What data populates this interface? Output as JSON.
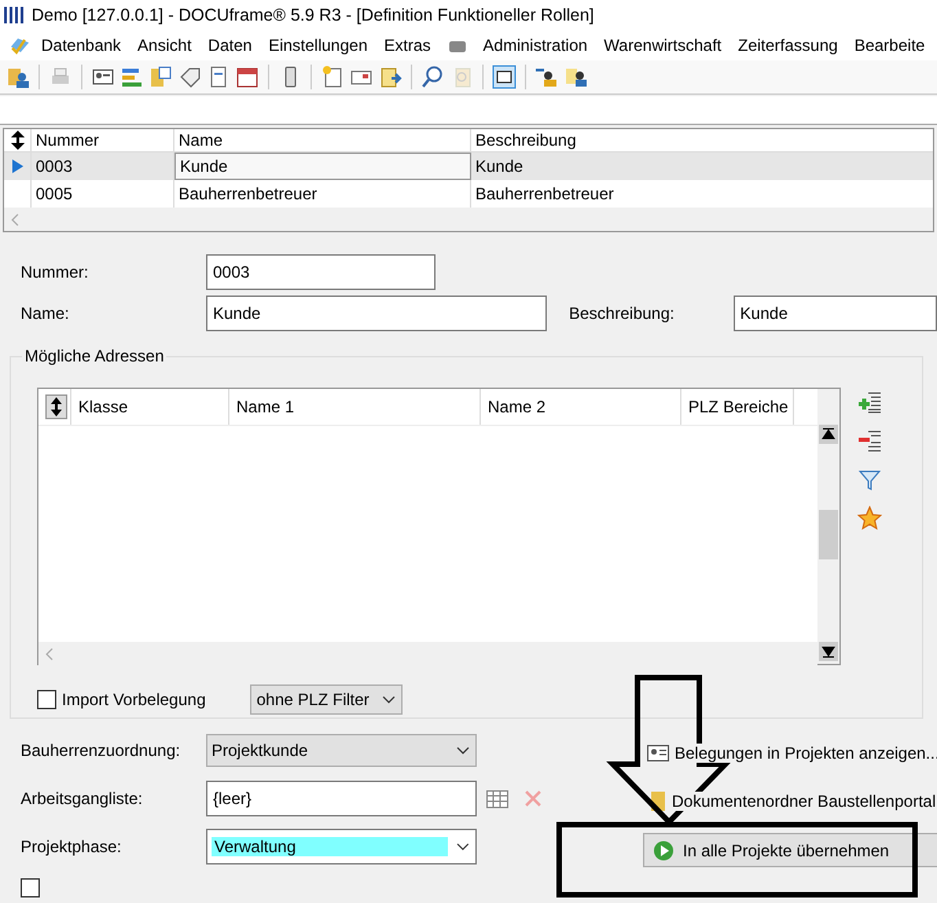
{
  "window": {
    "title": "Demo [127.0.0.1] - DOCUframe® 5.9 R3 - [Definition Funktioneller Rollen]"
  },
  "menu": [
    {
      "label": "Datenbank"
    },
    {
      "label": "Ansicht"
    },
    {
      "label": "Daten"
    },
    {
      "label": "Einstellungen"
    },
    {
      "label": "Extras"
    },
    {
      "label": "Administration"
    },
    {
      "label": "Warenwirtschaft"
    },
    {
      "label": "Zeiterfassung"
    },
    {
      "label": "Bearbeite"
    }
  ],
  "table": {
    "columns": [
      "Nummer",
      "Name",
      "Beschreibung"
    ],
    "rows": [
      {
        "cells": [
          "0003",
          "Kunde",
          "Kunde"
        ],
        "selected": true
      },
      {
        "cells": [
          "0005",
          "Bauherrenbetreuer",
          "Bauherrenbetreuer"
        ],
        "selected": false
      }
    ]
  },
  "form": {
    "nummer": {
      "label": "Nummer:",
      "value": "0003"
    },
    "name": {
      "label": "Name:",
      "value": "Kunde"
    },
    "beschreibung": {
      "label": "Beschreibung:",
      "value": "Kunde"
    }
  },
  "addresses": {
    "title": "Mögliche Adressen",
    "columns": [
      "Klasse",
      "Name 1",
      "Name 2",
      "PLZ Bereiche"
    ],
    "import": {
      "label": "Import Vorbelegung",
      "checked": false
    },
    "filter": {
      "value": "ohne PLZ Filter"
    }
  },
  "fields": [
    {
      "label": "Bauherrenzuordnung:",
      "value": "Projektkunde",
      "kind": "select"
    },
    {
      "label": "Arbeitsgangliste:",
      "value": "{leer}",
      "kind": "picker"
    },
    {
      "label": "Projektphase:",
      "value": "Verwaltung",
      "kind": "select",
      "highlighted": true
    }
  ],
  "export_checkbox": {
    "checked": false
  },
  "actions": [
    {
      "label": "Belegungen in Projekten anzeigen...",
      "kind": "link"
    },
    {
      "label": "Dokumentenordner Baustellenportal",
      "kind": "folder"
    },
    {
      "label": "In alle Projekte übernehmen",
      "kind": "button"
    }
  ]
}
